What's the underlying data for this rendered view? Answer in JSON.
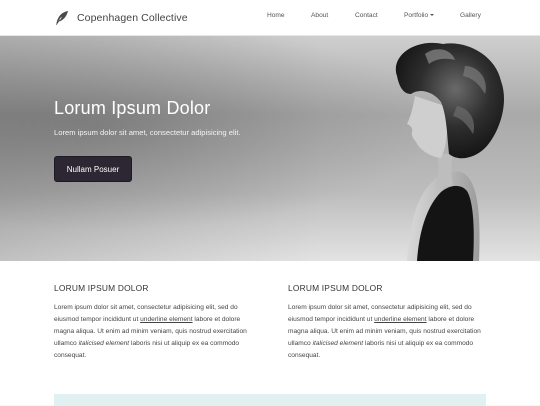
{
  "brand": {
    "name": "Copenhagen Collective",
    "icon": "feather-icon"
  },
  "nav": {
    "items": [
      "Home",
      "About",
      "Contact",
      "Portfolio",
      "Gallery"
    ]
  },
  "hero": {
    "title": "Lorum Ipsum Dolor",
    "subtitle": "Lorem ipsum dolor sit amet, consectetur adipisicing elit.",
    "button_label": "Nullam Posuer"
  },
  "columns": [
    {
      "title": "LORUM IPSUM DOLOR",
      "text_before": "Lorem ipsum dolor sit amet, consectetur adipisicing elit, sed do eiusmod tempor incididunt ut ",
      "underline": "underline element",
      "text_middle": " labore et dolore magna aliqua. Ut enim ad minim veniam, quis nostrud exercitation ullamco ",
      "italic": "italicised element",
      "text_after": " laboris nisi ut aliquip ex ea commodo consequat."
    },
    {
      "title": "LORUM IPSUM DOLOR",
      "text_before": "Lorem ipsum dolor sit amet, consectetur adipisicing elit, sed do eiusmod tempor incididunt ut ",
      "underline": "underline element",
      "text_middle": " labore et dolore magna aliqua. Ut enim ad minim veniam, quis nostrud exercitation ullamco ",
      "italic": "italicised element",
      "text_after": " laboris nisi ut aliquip ex ea commodo consequat."
    }
  ],
  "colors": {
    "button_bg": "#2c2732",
    "accent_bar": "#e1f0f1"
  }
}
